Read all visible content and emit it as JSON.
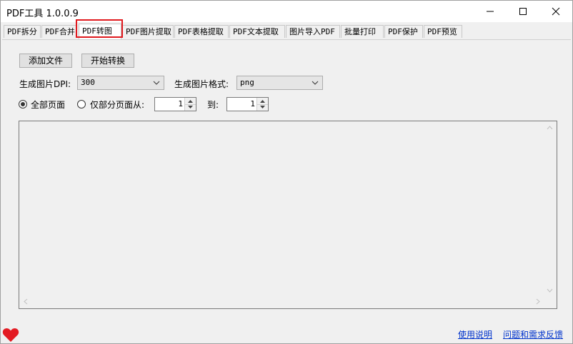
{
  "window": {
    "title": "PDF工具 1.0.0.9"
  },
  "tabs": [
    {
      "label": "PDF拆分"
    },
    {
      "label": "PDF合并"
    },
    {
      "label": "PDF转图"
    },
    {
      "label": "PDF图片提取"
    },
    {
      "label": "PDF表格提取"
    },
    {
      "label": "PDF文本提取"
    },
    {
      "label": "图片导入PDF"
    },
    {
      "label": "批量打印"
    },
    {
      "label": "PDF保护"
    },
    {
      "label": "PDF预览"
    }
  ],
  "active_tab": "PDF转图",
  "toolbar": {
    "add_files_label": "添加文件",
    "start_convert_label": "开始转换"
  },
  "settings": {
    "dpi_label": "生成图片DPI:",
    "dpi_value": "300",
    "format_label": "生成图片格式:",
    "format_value": "png"
  },
  "pages": {
    "all_pages_label": "全部页面",
    "all_pages_checked": true,
    "partial_pages_label": "仅部分页面从:",
    "from_value": "1",
    "to_label": "到:",
    "to_value": "1"
  },
  "footer": {
    "help_link": "使用说明",
    "feedback_link": "问题和需求反馈"
  },
  "colors": {
    "highlight": "#e0191e",
    "heart": "#e31b23",
    "link": "#0033cc"
  },
  "icons": {
    "minimize": "minimize-icon",
    "maximize": "maximize-icon",
    "close": "close-icon",
    "heart": "heart-icon"
  }
}
